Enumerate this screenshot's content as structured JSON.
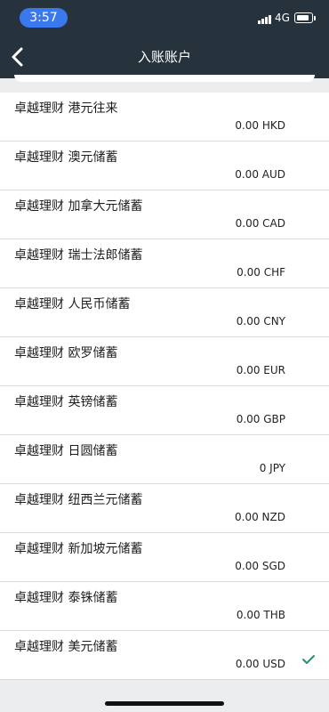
{
  "status_bar": {
    "time": "3:57",
    "network": "4G",
    "icons": [
      "signal-icon",
      "battery-icon"
    ]
  },
  "nav": {
    "title": "入账账户",
    "back_icon": "chevron-left-icon"
  },
  "accounts": [
    {
      "name": "卓越理财 港元往来",
      "amount": "0.00 HKD",
      "selected": false
    },
    {
      "name": "卓越理财 澳元储蓄",
      "amount": "0.00 AUD",
      "selected": false
    },
    {
      "name": "卓越理财 加拿大元储蓄",
      "amount": "0.00 CAD",
      "selected": false
    },
    {
      "name": "卓越理财 瑞士法郎储蓄",
      "amount": "0.00 CHF",
      "selected": false
    },
    {
      "name": "卓越理财 人民币储蓄",
      "amount": "0.00 CNY",
      "selected": false
    },
    {
      "name": "卓越理财 欧罗储蓄",
      "amount": "0.00 EUR",
      "selected": false
    },
    {
      "name": "卓越理财 英镑储蓄",
      "amount": "0.00 GBP",
      "selected": false
    },
    {
      "name": "卓越理财 日圆储蓄",
      "amount": "0 JPY",
      "selected": false
    },
    {
      "name": "卓越理财 纽西兰元储蓄",
      "amount": "0.00 NZD",
      "selected": false
    },
    {
      "name": "卓越理财 新加坡元储蓄",
      "amount": "0.00 SGD",
      "selected": false
    },
    {
      "name": "卓越理财 泰铢储蓄",
      "amount": "0.00 THB",
      "selected": false
    },
    {
      "name": "卓越理财 美元储蓄",
      "amount": "0.00 USD",
      "selected": true
    }
  ],
  "colors": {
    "header_bg": "#26333d",
    "time_pill": "#3a78ee",
    "check": "#2e8a75",
    "page_bg": "#ecedef"
  }
}
